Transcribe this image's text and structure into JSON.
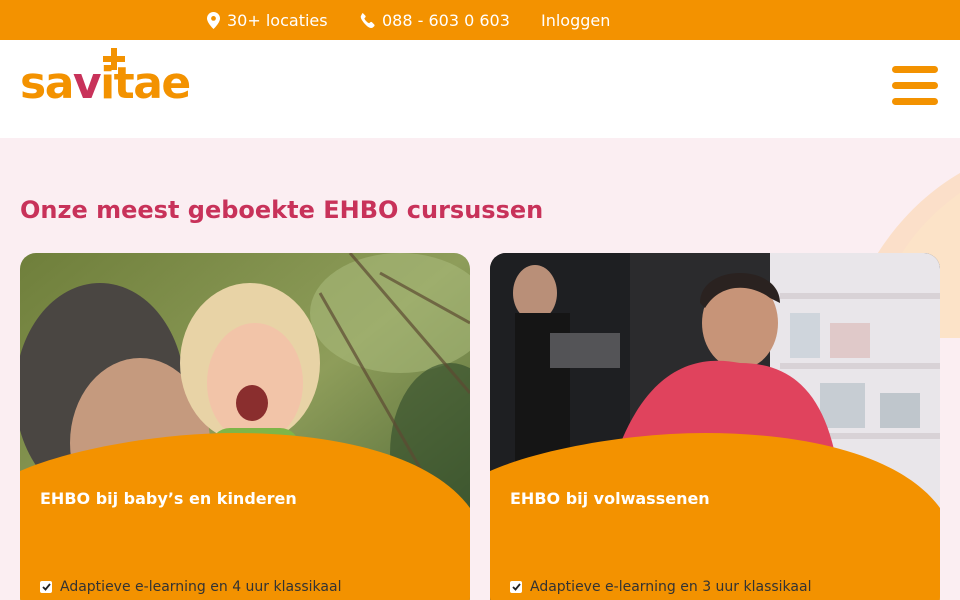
{
  "topbar": {
    "locations_label": "30+ locaties",
    "phone_label": "088 - 603 0 603",
    "login_label": "Inloggen"
  },
  "header": {
    "logo_part1": "sa",
    "logo_part2": "v",
    "logo_part3": "itae"
  },
  "section": {
    "title": "Onze meest geboekte EHBO cursussen"
  },
  "cards": [
    {
      "title": "EHBO bij baby’s en kinderen",
      "feature": "Adaptieve e-learning en 4 uur klassikaal"
    },
    {
      "title": "EHBO bij volwassenen",
      "feature": "Adaptieve e-learning en 3 uur klassikaal"
    }
  ],
  "icons": {
    "location": "map-pin-icon",
    "phone": "phone-icon",
    "menu": "hamburger-menu-icon",
    "check": "checkbox-checked-icon"
  },
  "colors": {
    "brand_orange": "#f39200",
    "brand_pink": "#c8325a",
    "section_background": "#fbeef2"
  }
}
